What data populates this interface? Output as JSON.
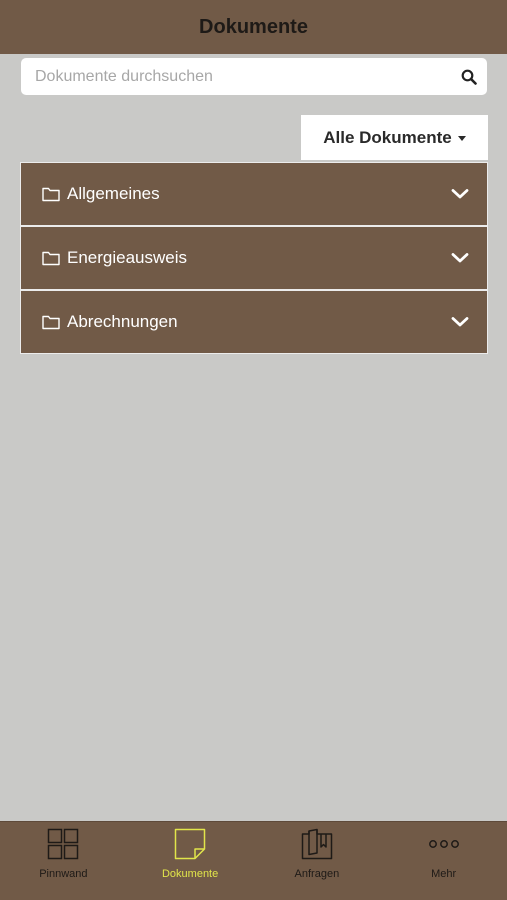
{
  "header": {
    "title": "Dokumente"
  },
  "search": {
    "placeholder": "Dokumente durchsuchen",
    "value": "",
    "icon": "search-icon"
  },
  "filter": {
    "label": "Alle Dokumente",
    "icon": "caret-down-icon"
  },
  "folders": [
    {
      "label": "Allgemeines",
      "icon": "folder-icon",
      "expand_icon": "chevron-down-icon"
    },
    {
      "label": "Energieausweis",
      "icon": "folder-icon",
      "expand_icon": "chevron-down-icon"
    },
    {
      "label": "Abrechnungen",
      "icon": "folder-icon",
      "expand_icon": "chevron-down-icon"
    }
  ],
  "tabbar": {
    "tabs": [
      {
        "label": "Pinnwand",
        "icon": "grid-icon",
        "active": false
      },
      {
        "label": "Dokumente",
        "icon": "note-icon",
        "active": true
      },
      {
        "label": "Anfragen",
        "icon": "book-icon",
        "active": false
      },
      {
        "label": "Mehr",
        "icon": "more-icon",
        "active": false
      }
    ]
  },
  "colors": {
    "brand": "#715a47",
    "background": "#c9c9c7",
    "active_tab": "#e1e54a",
    "inactive_tab": "#1e1a17"
  }
}
